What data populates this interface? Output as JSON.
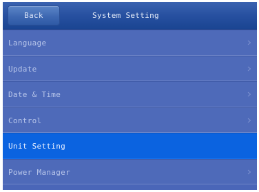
{
  "header": {
    "back_label": "Back",
    "title": "System Setting"
  },
  "menu": {
    "items": [
      {
        "label": "Language",
        "selected": false
      },
      {
        "label": "Update",
        "selected": false
      },
      {
        "label": "Date & Time",
        "selected": false
      },
      {
        "label": "Control",
        "selected": false
      },
      {
        "label": "Unit Setting",
        "selected": true
      },
      {
        "label": "Power Manager",
        "selected": false
      }
    ]
  },
  "icons": {
    "item_arrow": "chevron-right-icon"
  },
  "colors": {
    "header_bg": "#2750a0",
    "item_bg": "#4e6ab9",
    "selected_bg": "#0b63e0",
    "text": "#b8c6ea"
  }
}
